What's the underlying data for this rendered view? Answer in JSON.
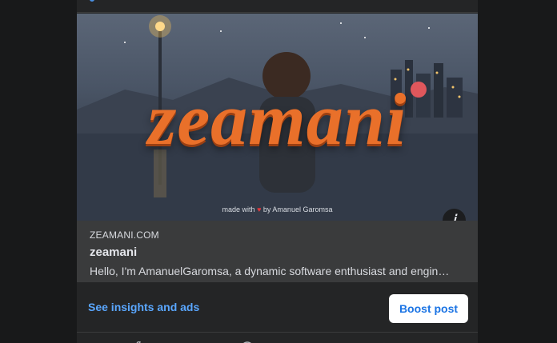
{
  "link_preview": {
    "image_brand": "zeamani",
    "made_with_prefix": "made with",
    "made_with_heart": "♥",
    "made_with_suffix": "by Amanuel Garomsa",
    "domain": "ZEAMANI.COM",
    "title": "zeamani",
    "description": "Hello, I'm AmanuelGaromsa, a dynamic software enthusiast and engin…",
    "info_icon": "ⅰ"
  },
  "actions": {
    "insights_label": "See insights and ads",
    "boost_label": "Boost post"
  },
  "icons": {
    "info": "info-icon",
    "like": "thumbs-up-icon",
    "comment": "comment-icon",
    "share": "share-icon"
  },
  "colors": {
    "background": "#18191a",
    "card": "#242526",
    "link_info": "#3a3b3c",
    "brand_orange": "#e9702a",
    "link_blue": "#5aa7ff",
    "boost_text": "#1b74e4"
  }
}
